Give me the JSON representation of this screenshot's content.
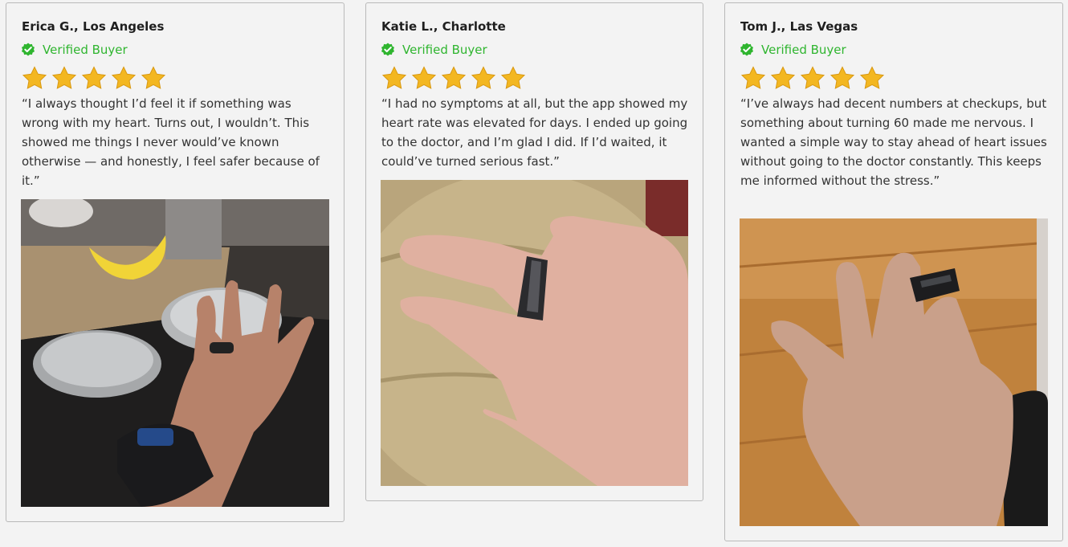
{
  "reviews": [
    {
      "name": "Erica G., Los Angeles",
      "verified": "Verified Buyer",
      "rating": 5,
      "quote": "“I always thought I’d feel it if something was wrong with my heart. Turns out, I wouldn’t. This showed me things I never would’ve known otherwise — and honestly, I feel safer because of it.”",
      "photo_alt": "hand-with-smart-ring-over-stove-photo"
    },
    {
      "name": "Katie L., Charlotte",
      "verified": "Verified Buyer",
      "rating": 5,
      "quote": "“I had no symptoms at all, but the app showed my heart rate was elevated for days. I ended up going to the doctor, and I’m glad I did. If I’d waited, it could’ve turned serious fast.”",
      "photo_alt": "hand-with-smart-ring-on-fabric-photo"
    },
    {
      "name": "Tom J., Las Vegas",
      "verified": "Verified Buyer",
      "rating": 5,
      "quote": "“I’ve always had decent numbers at checkups, but something about turning 60 made me nervous. I wanted a simple way to stay ahead of heart issues without going to the doctor constantly. This keeps me informed without the stress.”",
      "photo_alt": "hand-with-smart-ring-over-wood-floor-photo"
    }
  ],
  "colors": {
    "verified_green": "#2fb52f",
    "star_gold": "#f3b721",
    "card_border": "#b9b9b9"
  }
}
